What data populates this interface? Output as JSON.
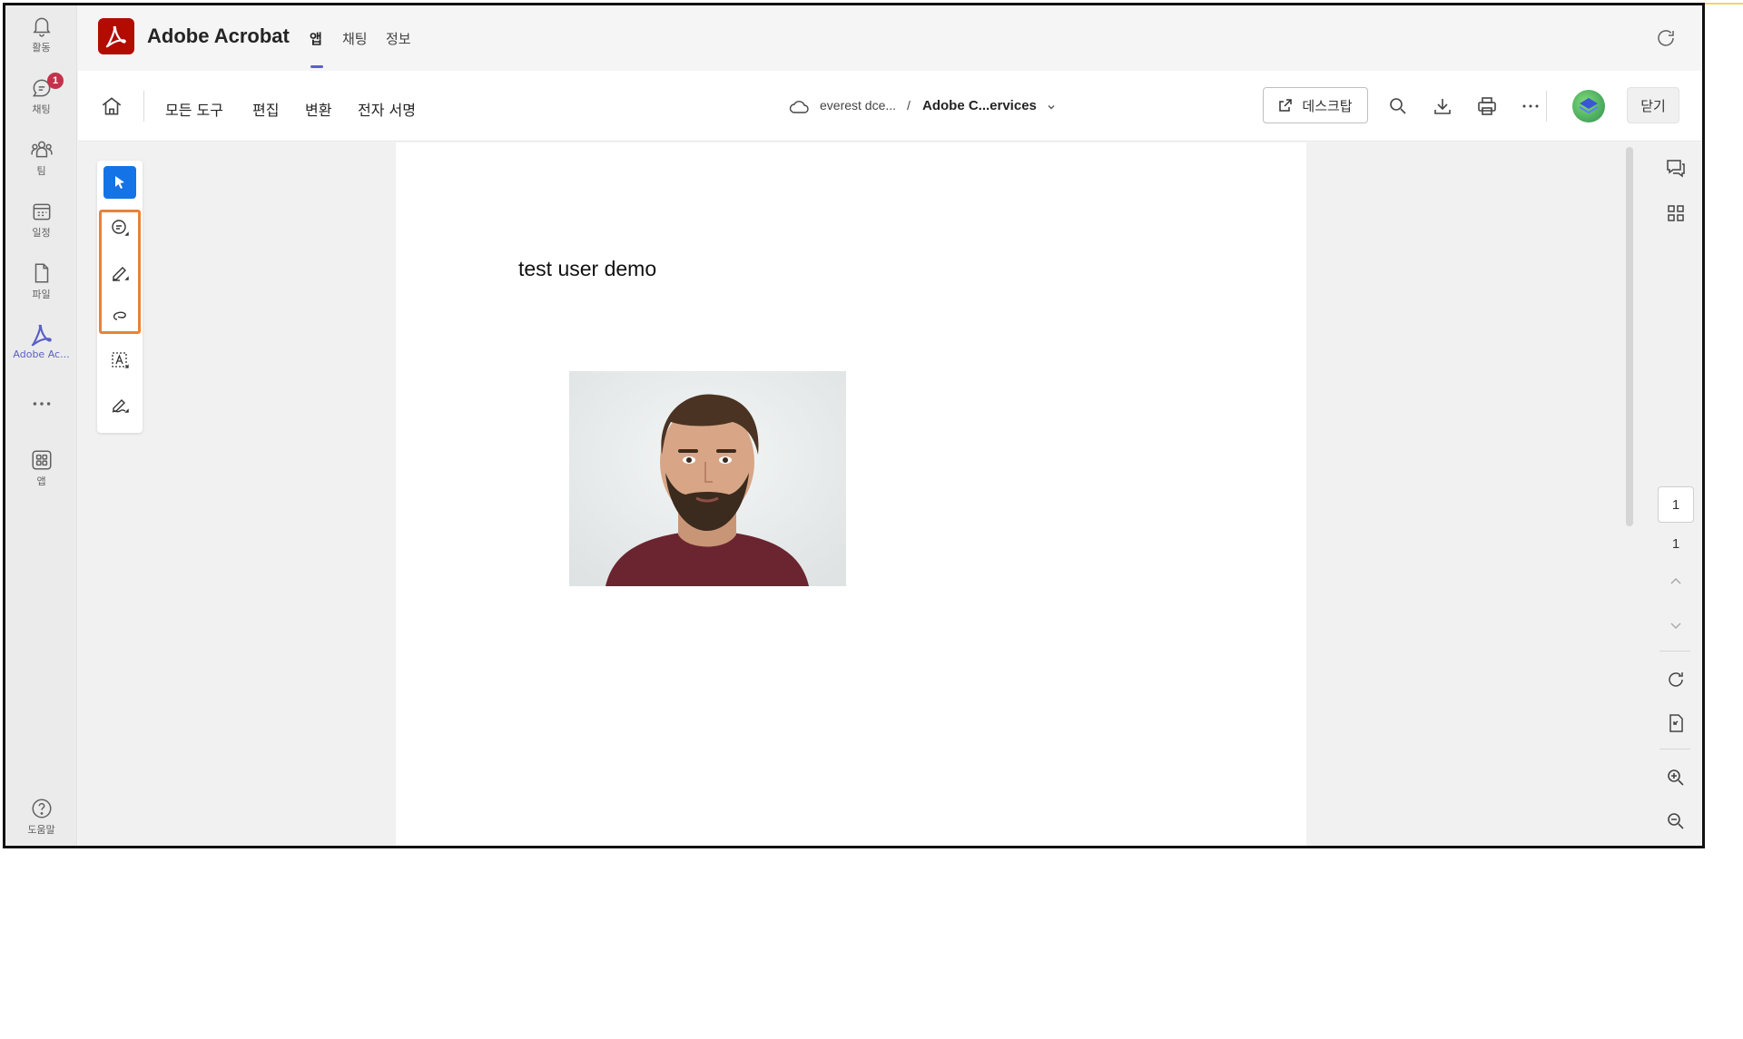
{
  "rail": {
    "items": [
      {
        "label": "활동",
        "icon": "bell-icon"
      },
      {
        "label": "채팅",
        "icon": "chat-icon",
        "badge": "1"
      },
      {
        "label": "팀",
        "icon": "teams-icon"
      },
      {
        "label": "일정",
        "icon": "calendar-icon"
      },
      {
        "label": "파일",
        "icon": "file-icon"
      },
      {
        "label": "Adobe Ac...",
        "icon": "acrobat-icon",
        "active": true
      },
      {
        "label": "",
        "icon": "more-icon"
      },
      {
        "label": "앱",
        "icon": "apps-icon"
      }
    ],
    "help_label": "도움말"
  },
  "app_header": {
    "title": "Adobe Acrobat",
    "tabs": [
      {
        "label": "앱",
        "active": true
      },
      {
        "label": "채팅"
      },
      {
        "label": "정보"
      }
    ]
  },
  "toolbar": {
    "menus": [
      "모든 도구",
      "편집",
      "변환",
      "전자 서명"
    ],
    "breadcrumb": {
      "location": "everest dce...",
      "separator": "/",
      "file": "Adobe C...ervices"
    },
    "desktop_label": "데스크탑",
    "close_label": "닫기"
  },
  "document": {
    "text": "test user demo"
  },
  "page_nav": {
    "current": "1",
    "total": "1"
  },
  "colors": {
    "accent": "#5b5fc7",
    "acrobat_red": "#b30b00",
    "tool_selected": "#1473e6",
    "highlight": "#e8833a",
    "badge": "#c4314b"
  }
}
